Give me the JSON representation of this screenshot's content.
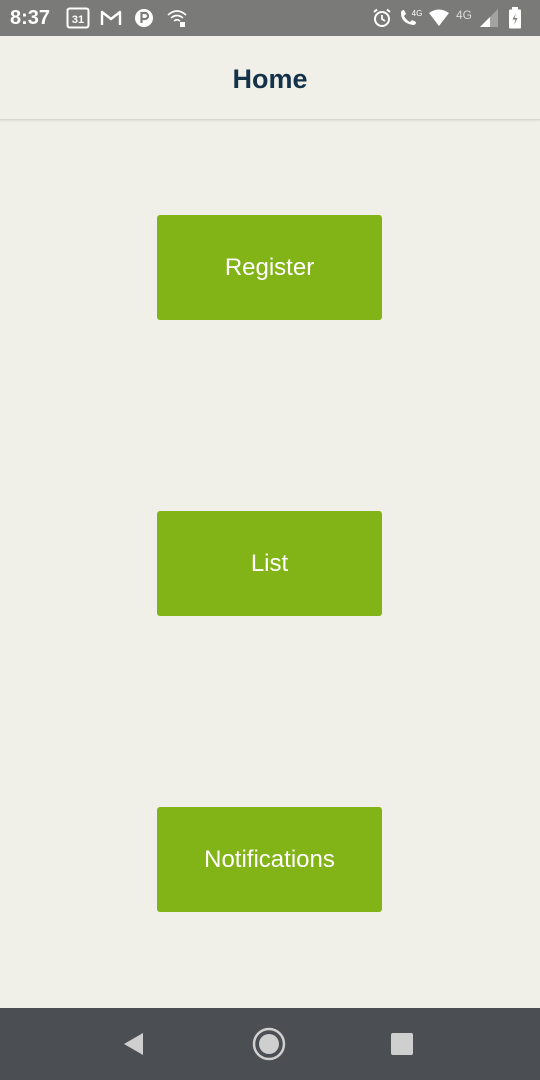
{
  "status_bar": {
    "time": "8:37",
    "calendar_day": "31",
    "network_left": "4G",
    "network_right": "4G",
    "icons": [
      "calendar-icon",
      "gmail-icon",
      "p-app-icon",
      "wifi-alert-icon",
      "alarm-icon",
      "volte-call-icon",
      "wifi-icon",
      "signal-icon",
      "battery-icon"
    ]
  },
  "app_bar": {
    "title": "Home"
  },
  "buttons": {
    "register": "Register",
    "list": "List",
    "notifications": "Notifications"
  },
  "nav_bar": {
    "icons": [
      "back-icon",
      "home-icon",
      "recents-icon"
    ]
  },
  "colors": {
    "button": "#82b317",
    "background": "#f1f0e8",
    "title": "#14324a",
    "status_bar": "#7a7a78",
    "nav_bar": "#4b4e53"
  }
}
